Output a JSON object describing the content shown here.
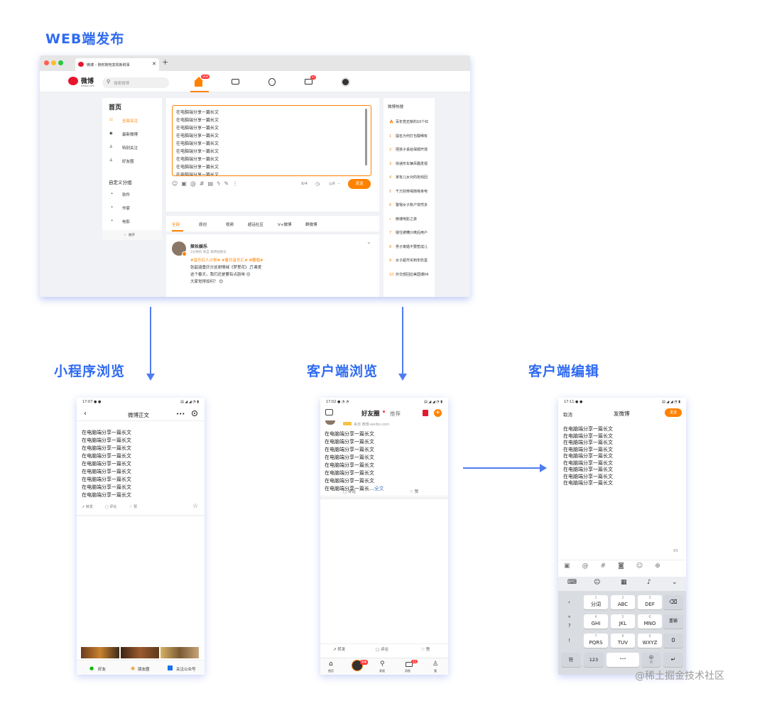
{
  "headings": {
    "web": "WEB端发布",
    "mini": "小程序浏览",
    "client_browse": "客户端浏览",
    "client_edit": "客户端编辑"
  },
  "web": {
    "tab_title": "微博 – 随时随地发现新鲜事",
    "logo_text": "微博",
    "logo_sub": "weibo.com",
    "search_placeholder": "搜索微博",
    "new_badge": "NEW",
    "msg_badge": "97",
    "left_menu": {
      "title": "首页",
      "items": [
        "全部关注",
        "最新微博",
        "特别关注",
        "好友圈"
      ],
      "group_title": "自定义分组",
      "groups": [
        "软件",
        "作家",
        "电影"
      ],
      "expand": "展开"
    },
    "editor_lines": [
      "在电脑端分享一篇长文",
      "在电脑端分享一篇长文",
      "在电脑端分享一篇长文",
      "在电脑端分享一篇长文",
      "在电脑端分享一篇长文",
      "在电脑端分享一篇长文",
      "在电脑端分享一篇长文",
      "在电脑端分享一篇长文",
      "在电脑端分享一篇长文"
    ],
    "count": "9/4",
    "visibility": "公开",
    "send": "发送",
    "feed_tabs": [
      "全部",
      "原创",
      "视频",
      "超话社区",
      "V+微博",
      "群微博"
    ],
    "post": {
      "author": "探长娱乐",
      "meta": "2分钟前 来自 微博视频号",
      "tags": "#音乐红人计划# #春日音乐汇# #翻唱#",
      "line1": "张韶涵重庆分这谢情绒《梦里花》🎵乘爱",
      "line2": "这个春天，我们还是要有点韵味 😊",
      "line3": "大家觉得如何？ 😊"
    },
    "hot": {
      "title": "微博热搜",
      "items": [
        {
          "rank": "🔥",
          "text": "百年党史薪的10个红"
        },
        {
          "rank": "1",
          "text": "提名为何打也酸稀有"
        },
        {
          "rank": "2",
          "text": "把孩子丢给保姆开境"
        },
        {
          "rank": "3",
          "text": "快递形车辆吊翻发视"
        },
        {
          "rank": "4",
          "text": "家有儿女对的抢戏回"
        },
        {
          "rank": "5",
          "text": "千万别穿褐随棉身电"
        },
        {
          "rank": "6",
          "text": "警惕女子账户突然多"
        },
        {
          "rank": "•",
          "text": "微博电影之夜"
        },
        {
          "rank": "7",
          "text": "疑住被糟沙离后用户"
        },
        {
          "rank": "8",
          "text": "男子离婚不要惹成儿"
        },
        {
          "rank": "9",
          "text": "女子超市买到年奶盒"
        },
        {
          "rank": "10",
          "text": "外交部回应美国博04"
        }
      ]
    }
  },
  "mini": {
    "time": "17:07",
    "title": "微博正文",
    "lines": [
      "在电脑端分享一篇长文",
      "在电脑端分享一篇长文",
      "在电脑端分享一篇长文",
      "在电脑端分享一篇长文",
      "在电脑端分享一篇长文",
      "在电脑端分享一篇长文",
      "在电脑端分享一篇长文",
      "在电脑端分享一篇长文",
      "在电脑端分享一篇长文"
    ],
    "repost": "转发",
    "comment": "评论",
    "like": "赞",
    "share_friend": "好友",
    "share_moments": "朋友圈",
    "follow": "关注公众号"
  },
  "client": {
    "time": "17:02",
    "tab_friends": "好友圈",
    "tab_recommend": "推荐",
    "sub": "来自 微博·weibo.com",
    "lines": [
      "在电脑端分享一篇长文",
      "在电脑端分享一篇长文",
      "在电脑端分享一篇长文",
      "在电脑端分享一篇长文",
      "在电脑端分享一篇长文",
      "在电脑端分享一篇长文",
      "在电脑端分享一篇长文"
    ],
    "last_line": "在电脑端分享一篇长...",
    "full": "全文",
    "comment": "评论",
    "like": "赞",
    "repost": "转发",
    "nav": [
      "首页",
      "",
      "发现",
      "消息",
      "我"
    ],
    "msg_badge": "43",
    "live_badge": "直播"
  },
  "edit": {
    "time": "17:11",
    "cancel": "取消",
    "title": "发微博",
    "send": "发送",
    "lines": [
      "在电脑端分享一篇长文",
      "在电脑端分享一篇长文",
      "在电脑端分享一篇长文",
      "在电脑端分享一篇长文",
      "在电脑端分享一篇长文",
      "在电脑端分享一篇长文",
      "在电脑端分享一篇长文",
      "在电脑端分享一篇长文",
      "在电脑端分享一篇长文"
    ],
    "count": "95",
    "keys": {
      "r1": [
        {
          "num": "1",
          "label": "分词"
        },
        {
          "num": "2",
          "label": "ABC"
        },
        {
          "num": "3",
          "label": "DEF"
        }
      ],
      "r2": [
        {
          "num": "4",
          "label": "GHI"
        },
        {
          "num": "5",
          "label": "JKL"
        },
        {
          "num": "6",
          "label": "MNO"
        }
      ],
      "r3": [
        {
          "num": "7",
          "label": "PQRS"
        },
        {
          "num": "8",
          "label": "TUV"
        },
        {
          "num": "9",
          "label": "WXYZ"
        }
      ],
      "rewrite": "重输",
      "zero": "0",
      "symbols": "符",
      "num123": "123",
      "lang": "中",
      "lang_sub": "英",
      "punct": [
        ",",
        "。",
        "?",
        "!"
      ]
    }
  },
  "watermark": "@稀土掘金技术社区",
  "colors": {
    "accent": "#2f6bf0",
    "brand": "#ff8200"
  }
}
